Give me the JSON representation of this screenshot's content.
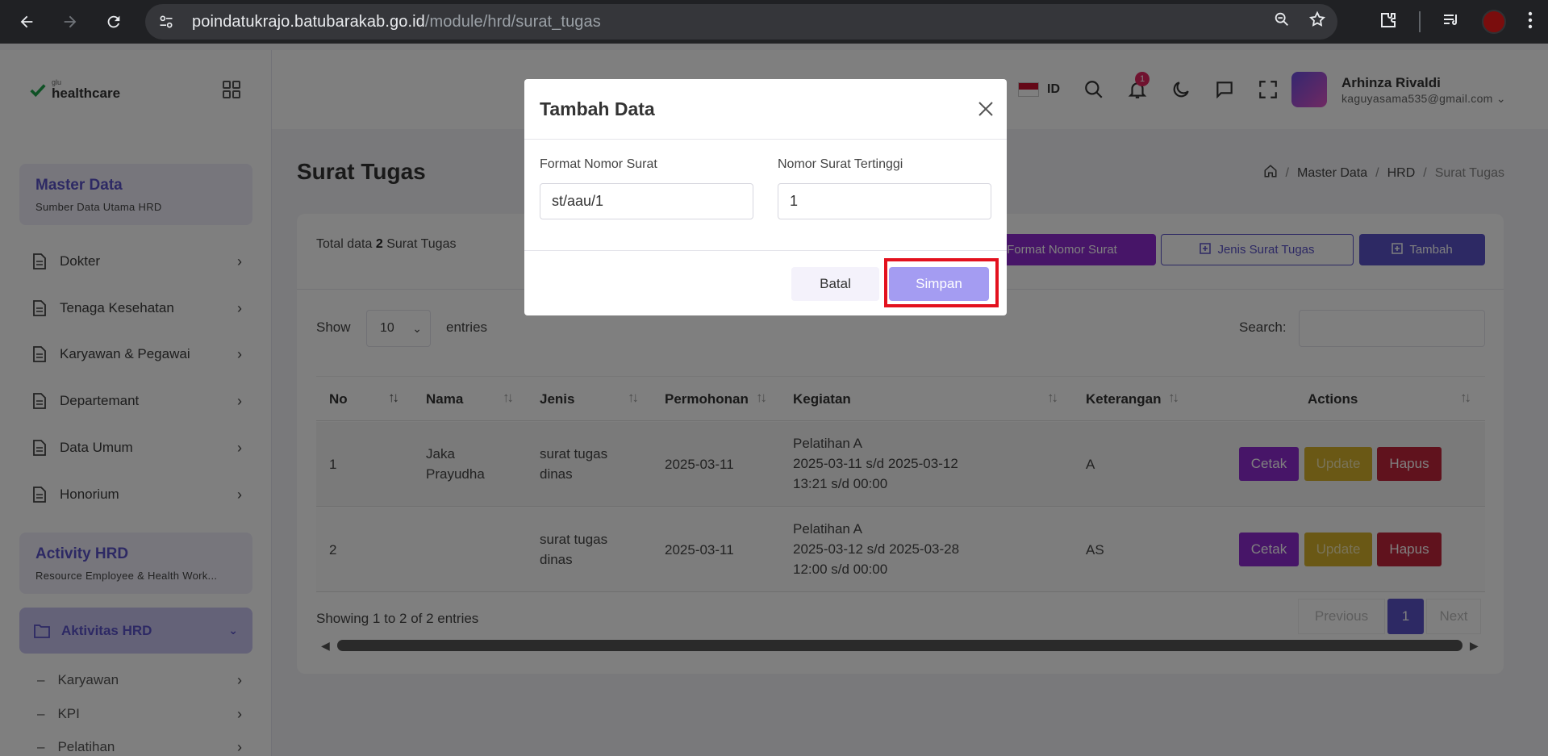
{
  "browser": {
    "url_host": "poindatukrajo.batubarakab.go.id",
    "url_path": "/module/hrd/surat_tugas"
  },
  "app": {
    "logo_small": "glu",
    "logo_text": "healthcare",
    "lang": "ID",
    "notification_count": "1",
    "user_name": "Arhinza Rivaldi",
    "user_email": "kaguyasama535@gmail.com"
  },
  "sidebar": {
    "master_title": "Master Data",
    "master_sub": "Sumber Data Utama HRD",
    "items": [
      {
        "label": "Dokter"
      },
      {
        "label": "Tenaga Kesehatan"
      },
      {
        "label": "Karyawan & Pegawai"
      },
      {
        "label": "Departemant"
      },
      {
        "label": "Data Umum"
      },
      {
        "label": "Honorium"
      }
    ],
    "activity_title": "Activity HRD",
    "activity_sub": "Resource Employee & Health Work...",
    "active_item": "Aktivitas HRD",
    "sub_items": [
      {
        "label": "Karyawan"
      },
      {
        "label": "KPI"
      },
      {
        "label": "Pelatihan"
      }
    ]
  },
  "page": {
    "title": "Surat Tugas",
    "breadcrumb": [
      "Master Data",
      "HRD",
      "Surat Tugas"
    ],
    "total_prefix": "Total data",
    "total_count": "2",
    "total_suffix": "Surat Tugas",
    "btn_format": "Format Nomor Surat",
    "btn_jenis": "Jenis Surat Tugas",
    "btn_tambah": "Tambah",
    "show_label": "Show",
    "show_value": "10",
    "entries_label": "entries",
    "search_label": "Search:",
    "showing": "Showing 1 to 2 of 2 entries",
    "prev": "Previous",
    "page_num": "1",
    "next": "Next"
  },
  "table": {
    "headers": [
      "No",
      "Nama",
      "Jenis",
      "Permohonan",
      "Kegiatan",
      "Keterangan",
      "Actions"
    ],
    "rows": [
      {
        "no": "1",
        "nama_1": "Jaka",
        "nama_2": "Prayudha",
        "jenis_1": "surat tugas",
        "jenis_2": "dinas",
        "permohonan": "2025-03-11",
        "kegiatan_1": "Pelatihan A",
        "kegiatan_2": "2025-03-11 s/d 2025-03-12",
        "kegiatan_3": "13:21 s/d 00:00",
        "keterangan": "A"
      },
      {
        "no": "2",
        "nama_1": "",
        "nama_2": "",
        "jenis_1": "surat tugas",
        "jenis_2": "dinas",
        "permohonan": "2025-03-11",
        "kegiatan_1": "Pelatihan A",
        "kegiatan_2": "2025-03-12 s/d 2025-03-28",
        "kegiatan_3": "12:00 s/d 00:00",
        "keterangan": "AS"
      }
    ],
    "actions": {
      "cetak": "Cetak",
      "update": "Update",
      "hapus": "Hapus"
    }
  },
  "modal": {
    "title": "Tambah Data",
    "label_format": "Format Nomor Surat",
    "value_format": "st/aau/1",
    "label_nomor": "Nomor Surat Tertinggi",
    "value_nomor": "1",
    "btn_batal": "Batal",
    "btn_simpan": "Simpan"
  },
  "colors": {
    "accent": "#5b53c9",
    "purple": "#8f2ad0",
    "highlight": "#e3111e"
  }
}
